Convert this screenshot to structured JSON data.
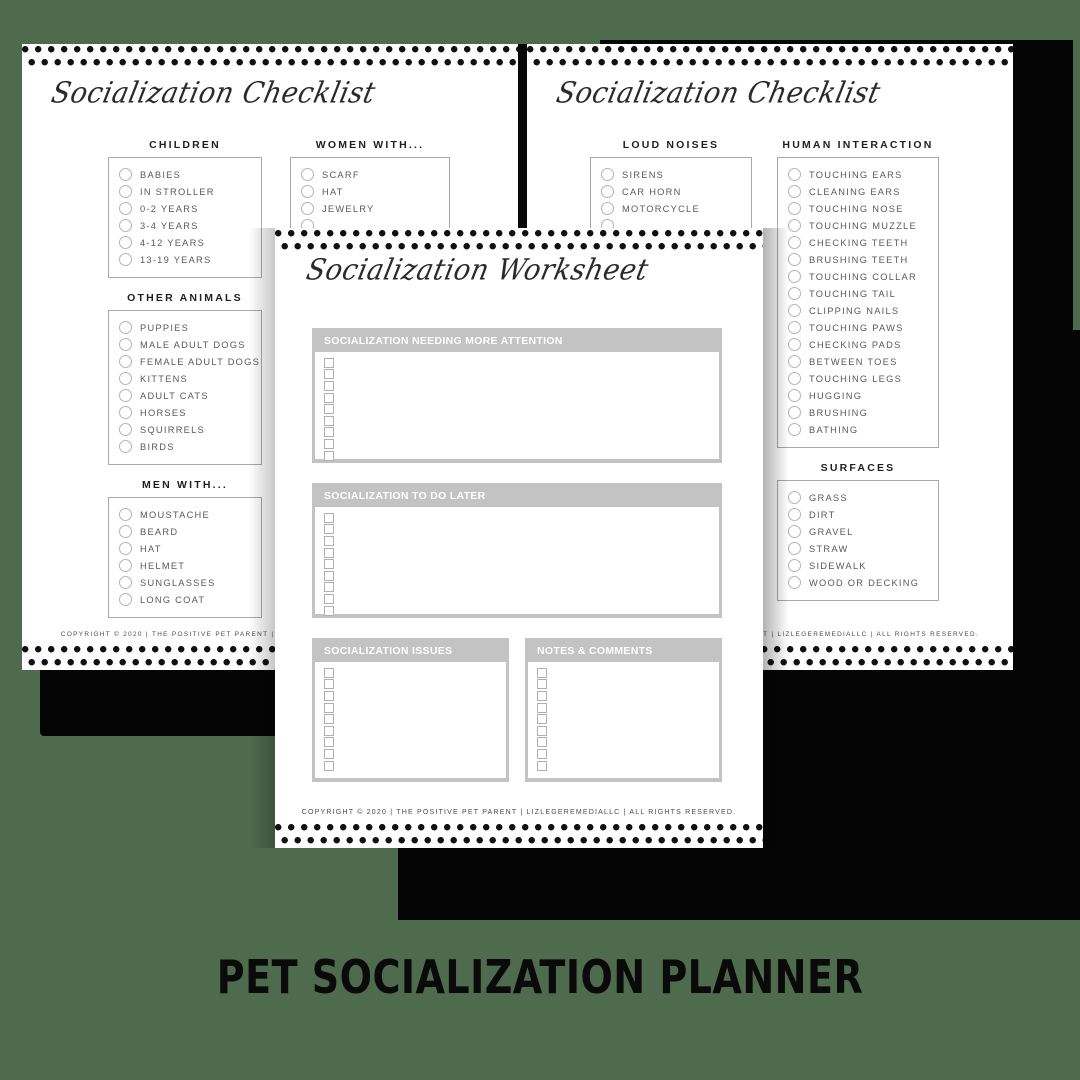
{
  "caption": "PET SOCIALIZATION PLANNER",
  "copyright": "COPYRIGHT © 2020 | THE POSITIVE PET PARENT | LIZLEGEREMEDIALLC | ALL RIGHTS RESERVED.",
  "colors": {
    "background": "#4e6b4e",
    "sheet": "#ffffff",
    "panel_header": "#c3c3c3",
    "dot": "#111111",
    "label_text": "#5a5a5a",
    "heading_text": "#1f1f1f"
  },
  "sheets": {
    "left": {
      "title": "Socialization Checklist",
      "groups": [
        {
          "title": "CHILDREN",
          "options": [
            "BABIES",
            "IN STROLLER",
            "0-2 YEARS",
            "3-4 YEARS",
            "4-12 YEARS",
            "13-19 YEARS"
          ]
        },
        {
          "title": "OTHER ANIMALS",
          "options": [
            "PUPPIES",
            "MALE ADULT DOGS",
            "FEMALE ADULT DOGS",
            "KITTENS",
            "ADULT CATS",
            "HORSES",
            "SQUIRRELS",
            "BIRDS"
          ]
        },
        {
          "title": "MEN WITH...",
          "options": [
            "MOUSTACHE",
            "BEARD",
            "HAT",
            "HELMET",
            "SUNGLASSES",
            "LONG COAT"
          ]
        },
        {
          "title": "WOMEN WITH...",
          "options": [
            "SCARF",
            "HAT",
            "JEWELRY"
          ]
        }
      ]
    },
    "right": {
      "title": "Socialization Checklist",
      "groups": [
        {
          "title": "LOUD NOISES",
          "options": [
            "SIRENS",
            "CAR HORN",
            "MOTORCYCLE"
          ]
        },
        {
          "title": "HUMAN INTERACTION",
          "options": [
            "TOUCHING EARS",
            "CLEANING EARS",
            "TOUCHING NOSE",
            "TOUCHING MUZZLE",
            "CHECKING TEETH",
            "BRUSHING TEETH",
            "TOUCHING COLLAR",
            "TOUCHING TAIL",
            "CLIPPING NAILS",
            "TOUCHING PAWS",
            "CHECKING PADS",
            "BETWEEN TOES",
            "TOUCHING LEGS",
            "HUGGING",
            "BRUSHING",
            "BATHING"
          ]
        },
        {
          "title": "SURFACES",
          "options": [
            "GRASS",
            "DIRT",
            "GRAVEL",
            "STRAW",
            "SIDEWALK",
            "WOOD OR DECKING"
          ]
        }
      ]
    },
    "center": {
      "title": "Socialization Worksheet",
      "panels": [
        {
          "header": "SOCIALIZATION NEEDING MORE ATTENTION",
          "rows": 9
        },
        {
          "header": "SOCIALIZATION TO DO LATER",
          "rows": 9
        },
        {
          "header": "SOCIALIZATION ISSUES",
          "rows": 9
        },
        {
          "header": "NOTES  & COMMENTS",
          "rows": 9
        }
      ]
    }
  }
}
